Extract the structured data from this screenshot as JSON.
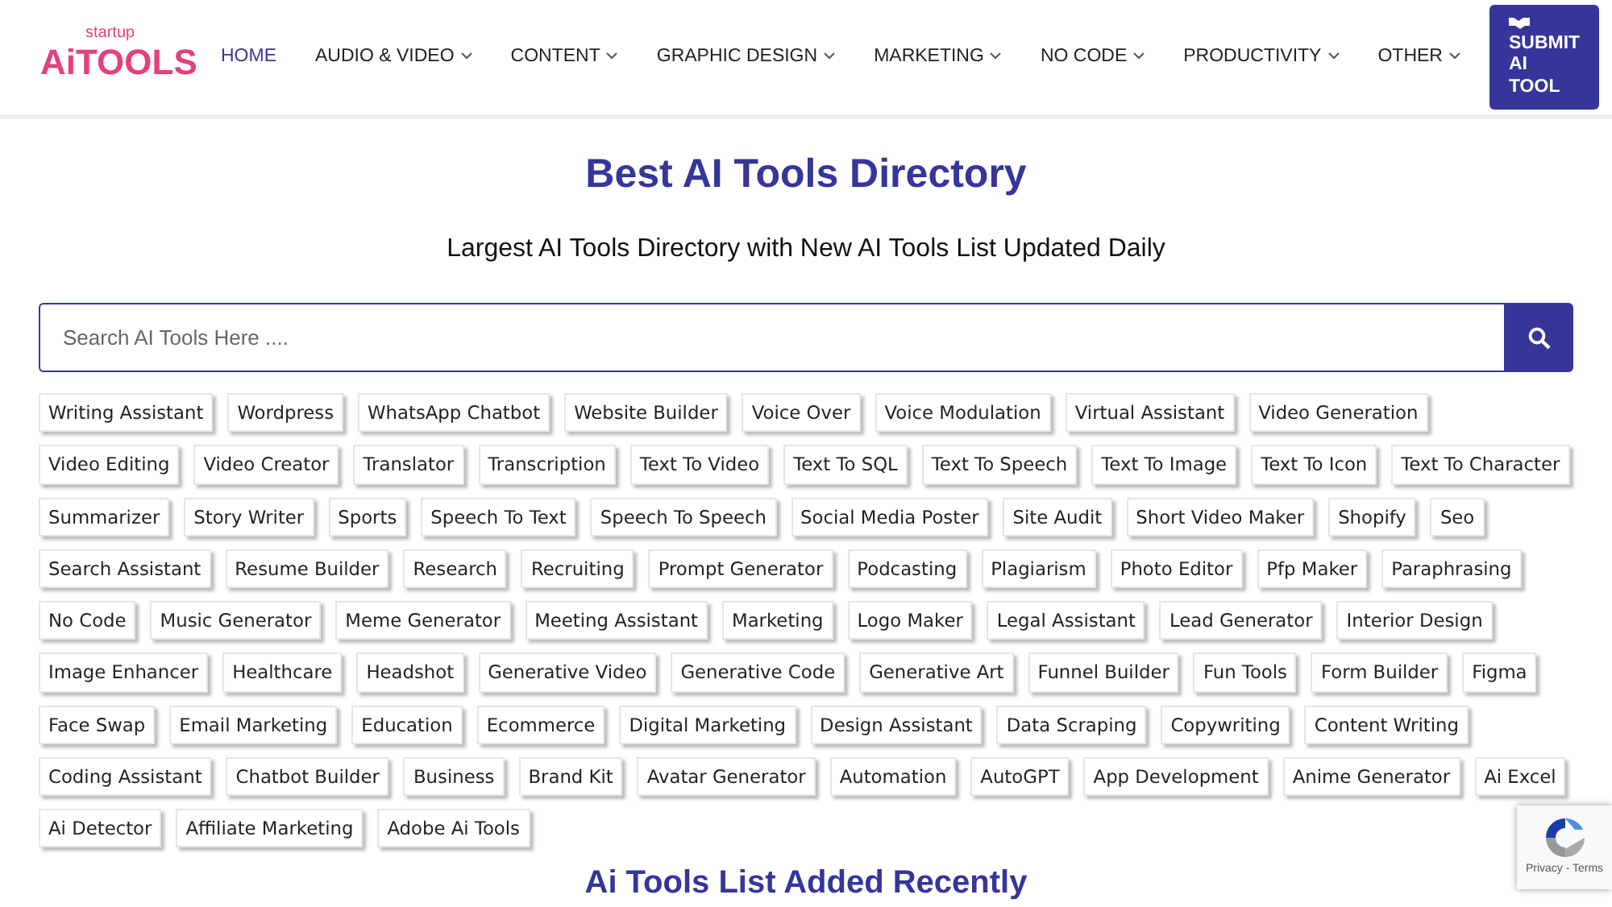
{
  "logo": {
    "tagline": "startup",
    "name": "AiTOOLS"
  },
  "nav": [
    {
      "label": "HOME",
      "selected": true,
      "dropdown": false
    },
    {
      "label": "AUDIO & VIDEO",
      "selected": false,
      "dropdown": true
    },
    {
      "label": "CONTENT",
      "selected": false,
      "dropdown": true
    },
    {
      "label": "GRAPHIC DESIGN",
      "selected": false,
      "dropdown": true
    },
    {
      "label": "MARKETING",
      "selected": false,
      "dropdown": true
    },
    {
      "label": "NO CODE",
      "selected": false,
      "dropdown": true
    },
    {
      "label": "PRODUCTIVITY",
      "selected": false,
      "dropdown": true
    },
    {
      "label": "OTHER",
      "selected": false,
      "dropdown": true
    }
  ],
  "submit_button": "SUBMIT AI TOOL",
  "title": "Best AI Tools Directory",
  "subtitle": "Largest AI Tools Directory with New AI Tools List Updated Daily",
  "search": {
    "placeholder": "Search AI Tools Here ...."
  },
  "tags": [
    "Writing Assistant",
    "Wordpress",
    "WhatsApp Chatbot",
    "Website Builder",
    "Voice Over",
    "Voice Modulation",
    "Virtual Assistant",
    "Video Generation",
    "Video Editing",
    "Video Creator",
    "Translator",
    "Transcription",
    "Text To Video",
    "Text To SQL",
    "Text To Speech",
    "Text To Image",
    "Text To Icon",
    "Text To Character",
    "Summarizer",
    "Story Writer",
    "Sports",
    "Speech To Text",
    "Speech To Speech",
    "Social Media Poster",
    "Site Audit",
    "Short Video Maker",
    "Shopify",
    "Seo",
    "Search Assistant",
    "Resume Builder",
    "Research",
    "Recruiting",
    "Prompt Generator",
    "Podcasting",
    "Plagiarism",
    "Photo Editor",
    "Pfp Maker",
    "Paraphrasing",
    "No Code",
    "Music Generator",
    "Meme Generator",
    "Meeting Assistant",
    "Marketing",
    "Logo Maker",
    "Legal Assistant",
    "Lead Generator",
    "Interior Design",
    "Image Enhancer",
    "Healthcare",
    "Headshot",
    "Generative Video",
    "Generative Code",
    "Generative Art",
    "Funnel Builder",
    "Fun Tools",
    "Form Builder",
    "Figma",
    "Face Swap",
    "Email Marketing",
    "Education",
    "Ecommerce",
    "Digital Marketing",
    "Design Assistant",
    "Data Scraping",
    "Copywriting",
    "Content Writing",
    "Coding Assistant",
    "Chatbot Builder",
    "Business",
    "Brand Kit",
    "Avatar Generator",
    "Automation",
    "AutoGPT",
    "App Development",
    "Anime Generator",
    "Ai Excel",
    "Ai Detector",
    "Affiliate Marketing",
    "Adobe Ai Tools"
  ],
  "section_heading": "Ai Tools List Added Recently",
  "recaptcha": {
    "links": "Privacy - Terms"
  }
}
